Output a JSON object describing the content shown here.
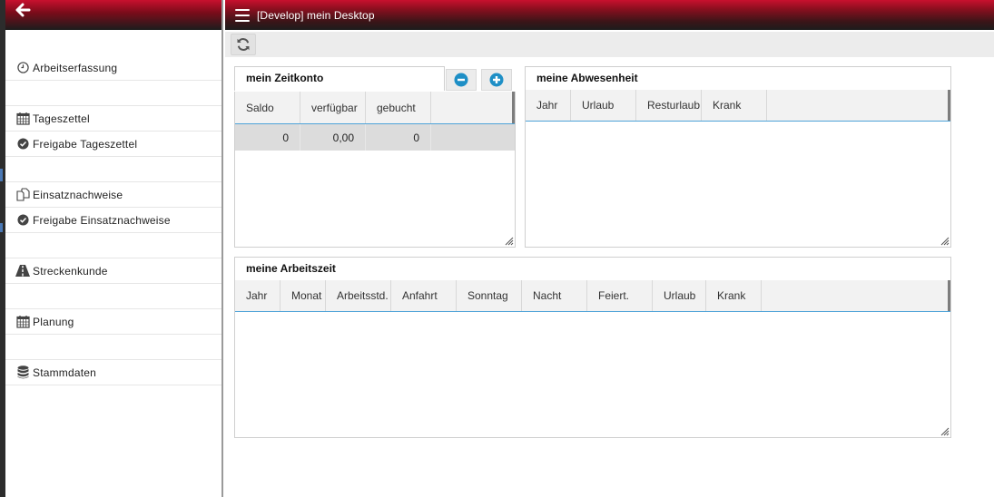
{
  "topbar": {
    "title": "[Develop] mein Desktop",
    "accent_color": "#c8102e"
  },
  "sidebar": {
    "items": [
      {
        "label": "Arbeitserfassung",
        "icon": "clock-icon"
      },
      {
        "label": "Tageszettel",
        "icon": "calendar-icon"
      },
      {
        "label": "Freigabe Tageszettel",
        "icon": "check-circle-icon"
      },
      {
        "label": "Einsatznachweise",
        "icon": "copy-icon"
      },
      {
        "label": "Freigabe Einsatznachweise",
        "icon": "check-circle-icon"
      },
      {
        "label": "Streckenkunde",
        "icon": "road-icon"
      },
      {
        "label": "Planung",
        "icon": "calendar-icon"
      },
      {
        "label": "Stammdaten",
        "icon": "database-icon"
      }
    ]
  },
  "zeitkonto": {
    "title": "mein Zeitkonto",
    "columns": [
      "Saldo",
      "verfügbar",
      "gebucht"
    ],
    "rows": [
      [
        "0",
        "0,00",
        "0"
      ]
    ]
  },
  "abwesenheit": {
    "title": "meine Abwesenheit",
    "columns": [
      "Jahr",
      "Urlaub",
      "Resturlaub",
      "Krank"
    ]
  },
  "arbeitszeit": {
    "title": "meine Arbeitszeit",
    "columns": [
      "Jahr",
      "Monat",
      "Arbeitsstd.",
      "Anfahrt",
      "Sonntag",
      "Nacht",
      "Feiert.",
      "Urlaub",
      "Krank"
    ]
  }
}
